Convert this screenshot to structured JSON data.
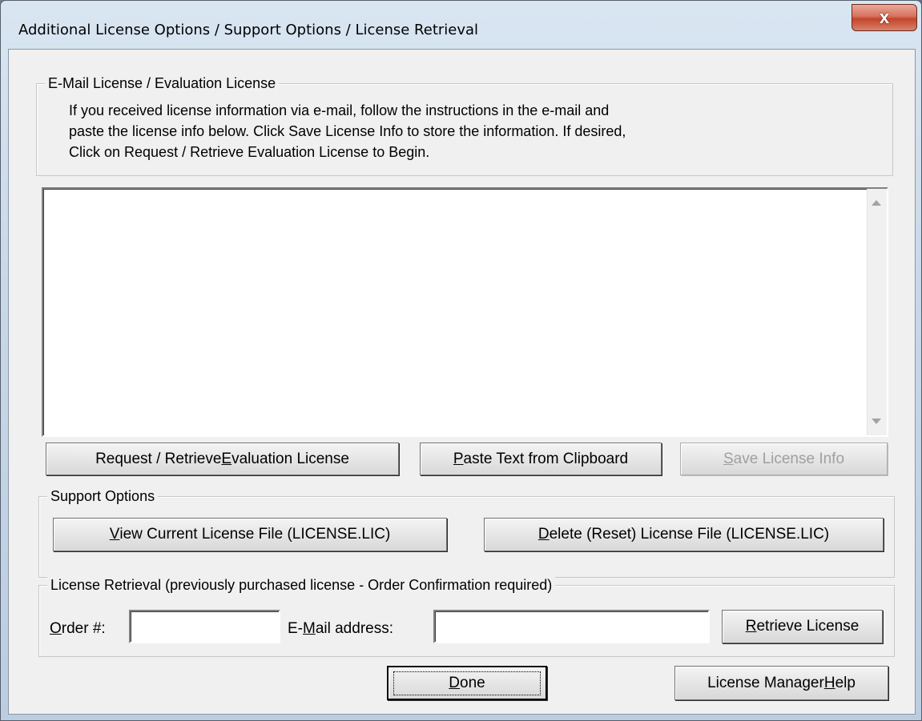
{
  "window": {
    "title": "Additional License Options / Support Options / License Retrieval",
    "close_glyph": "x"
  },
  "email_group": {
    "label": "E-Mail License / Evaluation License",
    "instructions": [
      "If you received license information via e-mail, follow the instructions in the e-mail and",
      "paste the license info below. Click Save License Info to store the information.  If desired,",
      "Click on Request / Retrieve Evaluation License to Begin."
    ],
    "license_text": ""
  },
  "buttons": {
    "request_eval": {
      "pre": "Request / Retrieve ",
      "key": "E",
      "post": "valuation License"
    },
    "paste": {
      "pre": "",
      "key": "P",
      "post": "aste Text from Clipboard"
    },
    "save": {
      "pre": "",
      "key": "S",
      "post": "ave License Info"
    },
    "view_license": {
      "pre": "",
      "key": "V",
      "post": "iew Current License File (LICENSE.LIC)"
    },
    "delete_license": {
      "pre": "",
      "key": "D",
      "post": "elete (Reset) License File (LICENSE.LIC)"
    },
    "retrieve": {
      "pre": "",
      "key": "R",
      "post": "etrieve License"
    },
    "done": {
      "pre": "",
      "key": "D",
      "post": "one"
    },
    "help": {
      "pre": "License Manager ",
      "key": "H",
      "post": "elp"
    }
  },
  "support_group": {
    "label": "Support Options"
  },
  "retrieval_group": {
    "label": "License Retrieval (previously purchased license - Order Confirmation required)",
    "order_label": {
      "pre": "",
      "key": "O",
      "post": "rder #:"
    },
    "email_label": {
      "pre": "E-",
      "key": "M",
      "post": "ail address:"
    },
    "order_value": "",
    "email_value": ""
  }
}
